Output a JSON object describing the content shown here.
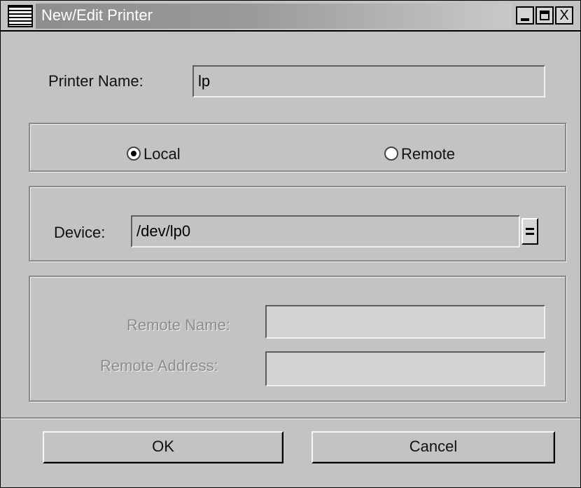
{
  "window": {
    "title": "New/Edit Printer",
    "controls": {
      "minimize": "_",
      "maximize": "□",
      "close": "X"
    }
  },
  "printer_name": {
    "label": "Printer Name:",
    "value": "lp"
  },
  "connection": {
    "local_label": "Local",
    "remote_label": "Remote",
    "selected": "Local"
  },
  "device": {
    "label": "Device:",
    "value": "/dev/lp0"
  },
  "remote": {
    "name_label": "Remote Name:",
    "name_value": "",
    "address_label": "Remote Address:",
    "address_value": ""
  },
  "buttons": {
    "ok": "OK",
    "cancel": "Cancel"
  },
  "icons": {
    "window_menu": "window-menu-icon",
    "combo_arrow": "dropdown-arrow-icon"
  },
  "colors": {
    "background": "#c3c3c3",
    "disabled_text": "#8c8c8c",
    "title_gradient_start": "#8e8e8e"
  }
}
